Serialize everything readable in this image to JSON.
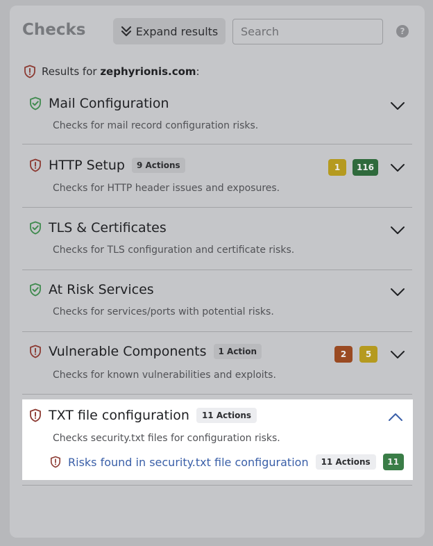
{
  "header": {
    "title": "Checks",
    "expand_label": "Expand results",
    "search_placeholder": "Search",
    "help_glyph": "?"
  },
  "results": {
    "prefix": "Results for ",
    "domain": "zephyrionis.com",
    "suffix": ":"
  },
  "sections": [
    {
      "title": "Mail Configuration",
      "description": "Checks for mail record configuration risks.",
      "status": "ok"
    },
    {
      "title": "HTTP Setup",
      "actions": "9 Actions",
      "description": "Checks for HTTP header issues and exposures.",
      "status": "risk",
      "badges": [
        {
          "value": "1",
          "color": "#b59a1f"
        },
        {
          "value": "116",
          "color": "#2f6a3c"
        }
      ]
    },
    {
      "title": "TLS & Certificates",
      "description": "Checks for TLS configuration and certificate risks.",
      "status": "ok"
    },
    {
      "title": "At Risk Services",
      "description": "Checks for services/ports with potential risks.",
      "status": "ok"
    },
    {
      "title": "Vulnerable Components",
      "actions": "1 Action",
      "description": "Checks for known vulnerabilities and exploits.",
      "status": "risk",
      "badges": [
        {
          "value": "2",
          "color": "#9a4a22"
        },
        {
          "value": "5",
          "color": "#b59a1f"
        }
      ]
    }
  ],
  "expanded": {
    "title": "TXT file configuration",
    "actions": "11 Actions",
    "description": "Checks security.txt files for configuration risks.",
    "sub": {
      "link": "Risks found in security.txt file configuration",
      "actions": "11 Actions",
      "badge": {
        "value": "11",
        "color": "#3a7d47"
      }
    }
  },
  "colors": {
    "ok_shield": "#3f8a4e",
    "risk_shield": "#8c3a32",
    "link": "#3a5fa8"
  }
}
